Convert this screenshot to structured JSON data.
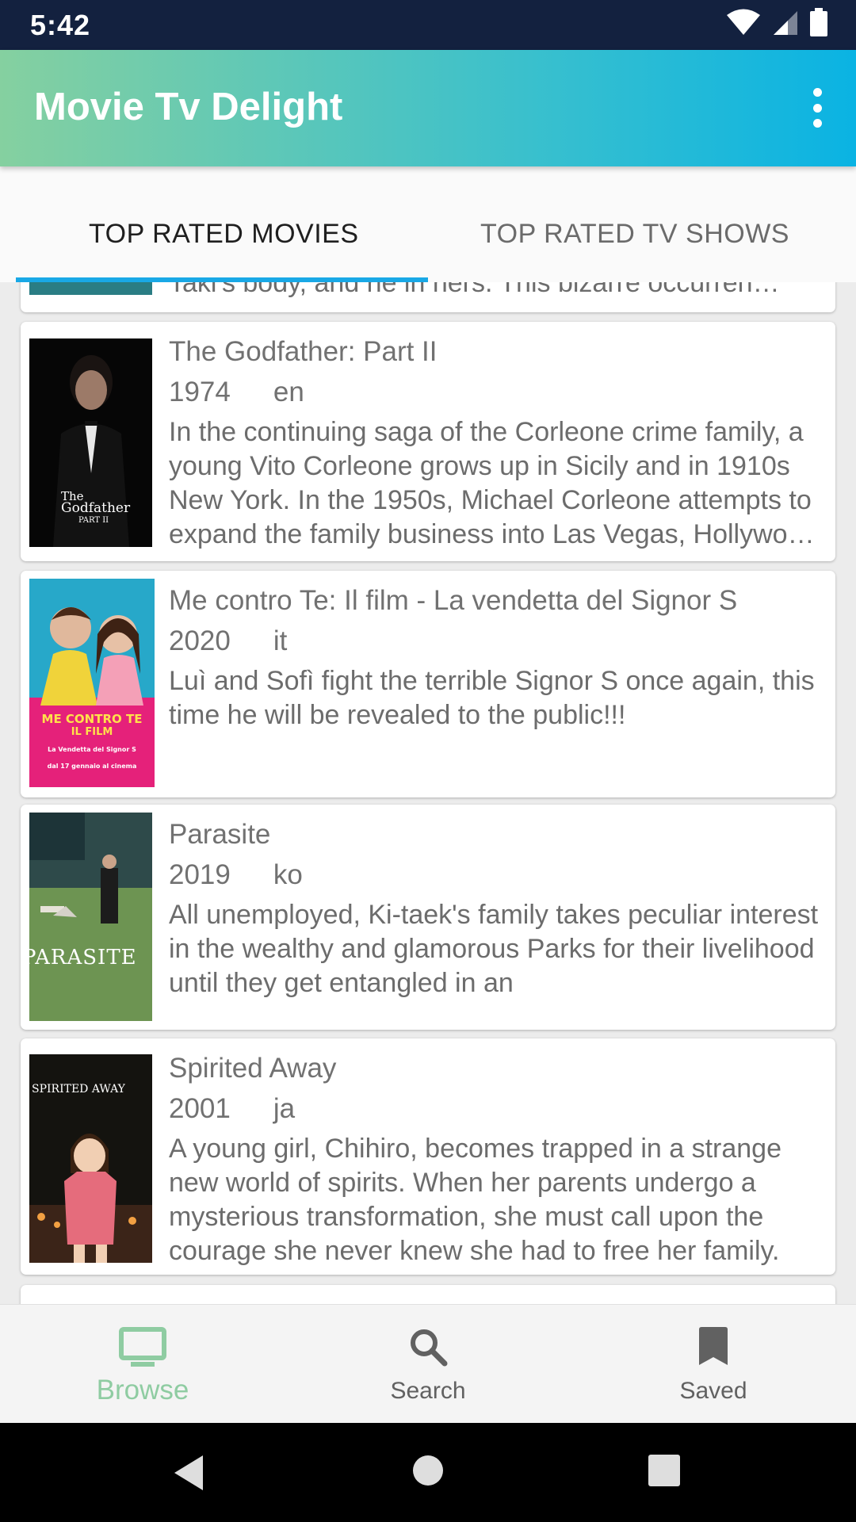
{
  "status_bar": {
    "time": "5:42"
  },
  "app_bar": {
    "title": "Movie Tv Delight"
  },
  "tabs": [
    {
      "label": "TOP RATED MOVIES",
      "selected": true
    },
    {
      "label": "TOP RATED TV SHOWS",
      "selected": false
    }
  ],
  "movies": [
    {
      "title": "",
      "year": "",
      "lang": "",
      "overview": "Taki's body, and he in hers. This bizarre occurren…"
    },
    {
      "title": "The Godfather: Part II",
      "year": "1974",
      "lang": "en",
      "overview": "In the continuing saga of the Corleone crime family, a young Vito Corleone grows up in Sicily and in 1910s New York. In the 1950s, Michael Corleone attempts to expand the family business into Las Vegas, Hollywood and Cuba."
    },
    {
      "title": "Me contro Te: Il film - La vendetta del Signor S",
      "year": "2020",
      "lang": "it",
      "overview": "Luì and Sofì fight the terrible Signor S once again, this time he will be revealed to the public!!!"
    },
    {
      "title": "Parasite",
      "year": "2019",
      "lang": "ko",
      "overview": "All unemployed, Ki-taek's family takes peculiar interest in the wealthy and glamorous Parks for their livelihood until they get entangled in an"
    },
    {
      "title": "Spirited Away",
      "year": "2001",
      "lang": "ja",
      "overview": "A young girl, Chihiro, becomes trapped in a strange new world of spirits. When her parents undergo a mysterious transformation, she must call upon the courage she never knew she had to free her family."
    }
  ],
  "posters": {
    "godfather": {
      "line1": "The",
      "line2": "Godfather",
      "line3": "PART II"
    },
    "mecontrote": {
      "line1": "ME CONTRO TE",
      "line2": "IL FILM",
      "line3": "La Vendetta del Signor S",
      "line4": "dal 17 gennaio al cinema"
    },
    "parasite": {
      "line1": "PARASITE"
    },
    "spirited": {
      "line1": "SPIRITED AWAY"
    }
  },
  "bottom_nav": [
    {
      "label": "Browse",
      "active": true
    },
    {
      "label": "Search",
      "active": false
    },
    {
      "label": "Saved",
      "active": false
    }
  ],
  "colors": {
    "status_bar": "#13213f",
    "app_bar_gradient_start": "#85d0a0",
    "app_bar_gradient_end": "#0ab3e3",
    "tab_indicator": "#19a8e6",
    "nav_active": "#8fcca2"
  },
  "icons": {
    "wifi": "wifi-icon",
    "signal": "signal-icon",
    "battery": "battery-icon",
    "overflow": "more-vert-icon",
    "browse": "tv-icon",
    "search": "search-icon",
    "saved": "bookmark-icon",
    "back": "back-icon",
    "home": "home-icon",
    "recents": "recents-icon"
  }
}
